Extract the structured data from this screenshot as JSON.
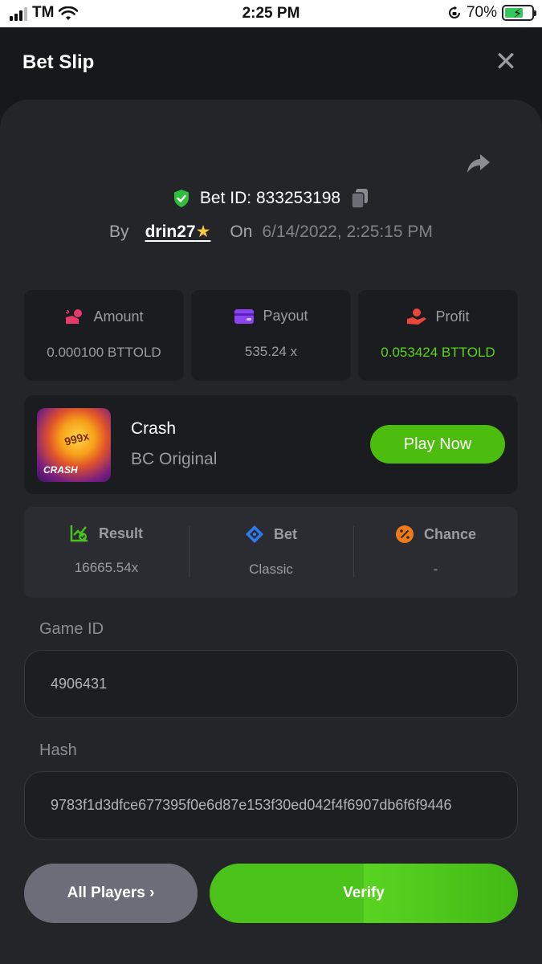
{
  "status_bar": {
    "carrier": "TM",
    "time": "2:25 PM",
    "battery": "70%",
    "battery_level": 0.7
  },
  "header": {
    "title": "Bet Slip",
    "close": "✕"
  },
  "bet": {
    "id_label": "Bet ID: 833253198",
    "by_label": "By",
    "username": "drin27",
    "on_label": "On",
    "date": "6/14/2022, 2:25:15 PM"
  },
  "stats": [
    {
      "label": "Amount",
      "value": "0.000100 BTTOLD",
      "icon": "amount-icon",
      "color": "#e83a6b"
    },
    {
      "label": "Payout",
      "value": "535.24 x",
      "icon": "wallet-icon",
      "color": "#8b44f0"
    },
    {
      "label": "Profit",
      "value": "0.053424 BTTOLD",
      "icon": "profit-icon",
      "color": "#e8473a"
    }
  ],
  "game": {
    "thumb_text": "999x",
    "thumb_label": "CRASH",
    "name": "Crash",
    "subtitle": "BC Original",
    "play_label": "Play Now"
  },
  "details": [
    {
      "label": "Result",
      "value": "16665.54x",
      "icon": "chart-check-icon",
      "color": "#4cc31b"
    },
    {
      "label": "Bet",
      "value": "Classic",
      "icon": "diamond-icon",
      "color": "#2e7bf0"
    },
    {
      "label": "Chance",
      "value": "-",
      "icon": "percent-icon",
      "color": "#f07a1a"
    }
  ],
  "game_id": {
    "label": "Game ID",
    "value": "4906431"
  },
  "hash": {
    "label": "Hash",
    "value": "9783f1d3dfce677395f0e6d87e153f30ed042f4f6907db6f6f9446"
  },
  "buttons": {
    "all_players": "All Players",
    "verify": "Verify"
  },
  "colors": {
    "accent_green": "#4cbc0f",
    "profit_green": "#5bd41a"
  }
}
